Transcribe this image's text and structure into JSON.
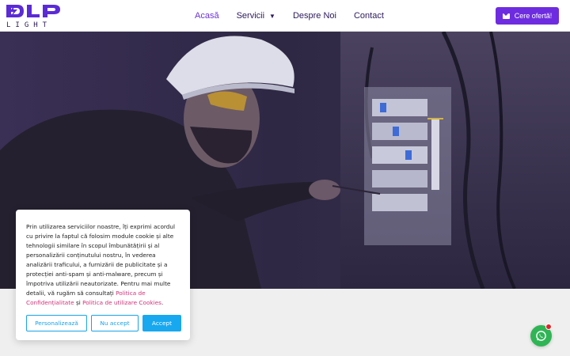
{
  "brand": {
    "name": "DLP",
    "sub": "LIGHT",
    "logo_icon": "lightning-bolt-icon",
    "colors": {
      "logo": "#5b2bd6",
      "accent": "#6e2ce0"
    }
  },
  "nav": {
    "items": [
      {
        "label": "Acasă",
        "active": true
      },
      {
        "label": "Servicii",
        "has_dropdown": true
      },
      {
        "label": "Despre Noi"
      },
      {
        "label": "Contact"
      }
    ],
    "cta_label": "Cere ofertă!",
    "cta_icon": "envelope-icon"
  },
  "cookie": {
    "text_before": "Prin utilizarea serviciilor noastre, îți exprimi acordul cu privire la faptul că folosim module cookie și alte tehnologii similare în scopul îmbunătățirii și al personalizării conținutului nostru, în vederea analizării traficului, a furnizării de publicitate și a protecției anti-spam și anti-malware, precum și împotriva utilizării neautorizate. Pentru mai multe detalii, vă rugăm să consultați ",
    "link1": "Politica de Confidențialitate",
    "middle": " și ",
    "link2": "Politica de utilizare Cookies",
    "end": ".",
    "buttons": {
      "customize": "Personalizează",
      "reject": "Nu accept",
      "accept": "Accept"
    },
    "colors": {
      "link": "#d2337a",
      "button": "#17a8f0"
    }
  },
  "whatsapp": {
    "icon": "whatsapp-icon",
    "color": "#2fb555"
  }
}
